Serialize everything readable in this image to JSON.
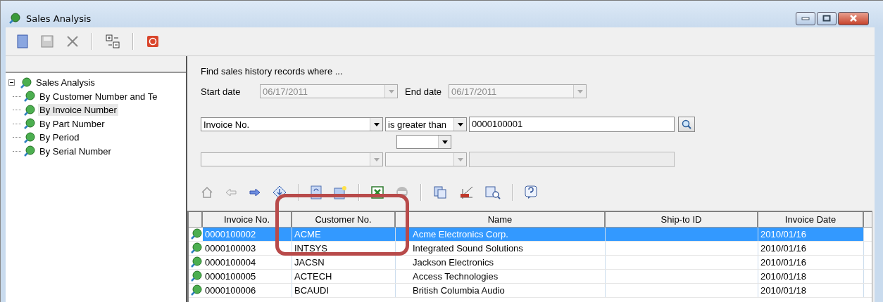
{
  "window": {
    "title": "Sales Analysis"
  },
  "tree": {
    "label": "Sales Analysis",
    "expanded": true,
    "children": [
      {
        "label": "By Customer Number and Te",
        "selected": false
      },
      {
        "label": "By Invoice Number",
        "selected": true
      },
      {
        "label": "By Part Number",
        "selected": false
      },
      {
        "label": "By Period",
        "selected": false
      },
      {
        "label": "By Serial Number",
        "selected": false
      }
    ]
  },
  "search": {
    "heading": "Find sales history records where ...",
    "start_date": {
      "label": "Start date",
      "value": "06/17/2011",
      "disabled": true
    },
    "end_date": {
      "label": "End date",
      "value": "06/17/2011",
      "disabled": true
    },
    "criteria": [
      {
        "field": "Invoice No.",
        "operator": "is greater than",
        "value": "0000100001",
        "disabled": false
      },
      {
        "disabled": true
      }
    ]
  },
  "grid": {
    "columns": [
      "Invoice No.",
      "Customer No.",
      "Name",
      "Ship-to ID",
      "Invoice Date"
    ],
    "rows": [
      {
        "cells": [
          "0000100002",
          "ACME",
          "Acme Electronics Corp.",
          "",
          "2010/01/16"
        ],
        "selected": true
      },
      {
        "cells": [
          "0000100003",
          "INTSYS",
          "Integrated Sound Solutions",
          "",
          "2010/01/16"
        ],
        "selected": false
      },
      {
        "cells": [
          "0000100004",
          "JACSN",
          "Jackson Electronics",
          "",
          "2010/01/16"
        ],
        "selected": false
      },
      {
        "cells": [
          "0000100005",
          "ACTECH",
          "Access Technologies",
          "",
          "2010/01/18"
        ],
        "selected": false
      },
      {
        "cells": [
          "0000100006",
          "BCAUDI",
          "British Columbia Audio",
          "",
          "2010/01/18"
        ],
        "selected": false
      }
    ]
  }
}
